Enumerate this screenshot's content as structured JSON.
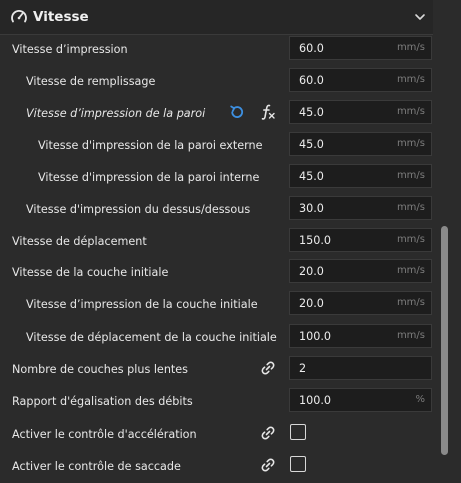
{
  "section": {
    "title": "Vitesse",
    "icon": "speedometer-icon",
    "collapse_icon": "chevron-down-icon"
  },
  "rows": [
    {
      "label": "Vitesse d’impression",
      "value": "60.0",
      "unit": "mm/s"
    },
    {
      "label": "Vitesse de remplissage",
      "value": "60.0",
      "unit": "mm/s"
    },
    {
      "label": "Vitesse d’impression de la paroi",
      "value": "45.0",
      "unit": "mm/s",
      "icons": [
        "reset-icon",
        "function-icon"
      ]
    },
    {
      "label": "Vitesse d'impression de la paroi externe",
      "value": "45.0",
      "unit": "mm/s"
    },
    {
      "label": "Vitesse d'impression de la paroi interne",
      "value": "45.0",
      "unit": "mm/s"
    },
    {
      "label": "Vitesse d'impression du dessus/dessous",
      "value": "30.0",
      "unit": "mm/s"
    },
    {
      "label": "Vitesse de déplacement",
      "value": "150.0",
      "unit": "mm/s"
    },
    {
      "label": "Vitesse de la couche initiale",
      "value": "20.0",
      "unit": "mm/s"
    },
    {
      "label": "Vitesse d’impression de la couche initiale",
      "value": "20.0",
      "unit": "mm/s"
    },
    {
      "label": "Vitesse de déplacement de la couche initiale",
      "value": "100.0",
      "unit": "mm/s"
    },
    {
      "label": "Nombre de couches plus lentes",
      "value": "2",
      "unit": "",
      "icons": [
        "link-icon"
      ]
    },
    {
      "label": "Rapport d'égalisation des débits",
      "value": "100.0",
      "unit": "%"
    },
    {
      "label": "Activer le contrôle d'accélération",
      "checked": false,
      "icons": [
        "link-icon"
      ]
    },
    {
      "label": "Activer le contrôle de saccade",
      "checked": false,
      "icons": [
        "link-icon"
      ]
    }
  ],
  "colors": {
    "background": "#2b2b2b",
    "field": "#1d1d1d",
    "accent_reset": "#3d8fe0"
  }
}
